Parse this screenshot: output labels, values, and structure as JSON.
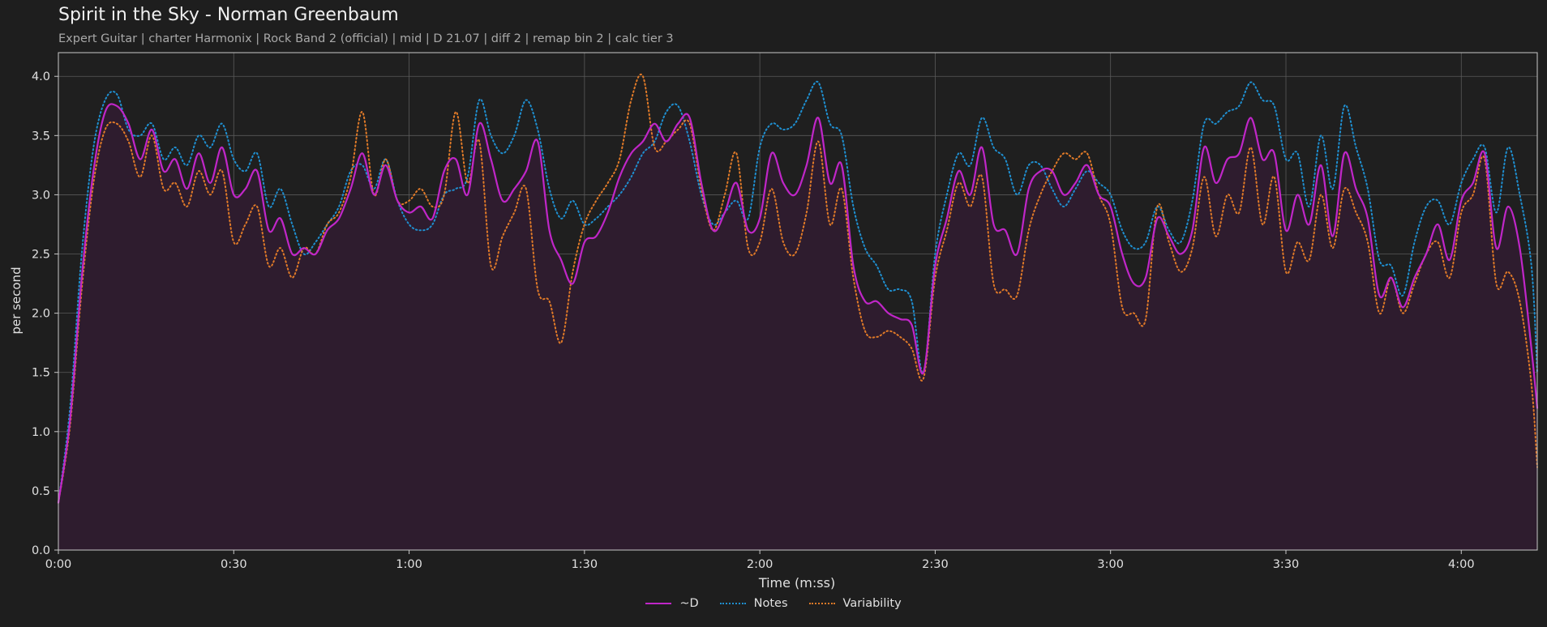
{
  "header": {
    "title": "Spirit in the Sky - Norman Greenbaum",
    "subtitle": "Expert Guitar  |  charter Harmonix  |  Rock Band 2 (official)  |  mid  |  D 21.07  |  diff 2  |  remap bin 2  |  calc tier 3"
  },
  "colors": {
    "background": "#1e1e1e",
    "d": "#c026c8",
    "d_fill": "#2e1c2e",
    "notes": "#1f8fd0",
    "variability": "#e07a28",
    "grid": "#5a5a5a",
    "axis": "#c8c8c8"
  },
  "chart_data": {
    "type": "line",
    "title": "Spirit in the Sky - Norman Greenbaum",
    "xlabel": "Time (m:ss)",
    "ylabel": "per second",
    "xlim": [
      0,
      253
    ],
    "ylim": [
      0,
      4.2
    ],
    "grid": true,
    "legend_position": "bottom-center",
    "x_ticks": [
      0,
      30,
      60,
      90,
      120,
      150,
      180,
      210,
      240
    ],
    "x_tick_labels": [
      "0:00",
      "0:30",
      "1:00",
      "1:30",
      "2:00",
      "2:30",
      "3:00",
      "3:30",
      "4:00"
    ],
    "y_ticks": [
      0,
      0.5,
      1.0,
      1.5,
      2.0,
      2.5,
      3.0,
      3.5,
      4.0
    ],
    "y_tick_labels": [
      "0.0",
      "0.5",
      "1.0",
      "1.5",
      "2.0",
      "2.5",
      "3.0",
      "3.5",
      "4.0"
    ],
    "x": [
      0,
      2,
      4,
      6,
      8,
      10,
      12,
      14,
      16,
      18,
      20,
      22,
      24,
      26,
      28,
      30,
      32,
      34,
      36,
      38,
      40,
      42,
      44,
      46,
      48,
      50,
      52,
      54,
      56,
      58,
      60,
      62,
      64,
      66,
      68,
      70,
      72,
      74,
      76,
      78,
      80,
      82,
      84,
      86,
      88,
      90,
      92,
      94,
      96,
      98,
      100,
      102,
      104,
      106,
      108,
      110,
      112,
      114,
      116,
      118,
      120,
      122,
      124,
      126,
      128,
      130,
      132,
      134,
      136,
      138,
      140,
      142,
      144,
      146,
      148,
      150,
      152,
      154,
      156,
      158,
      160,
      162,
      164,
      166,
      168,
      170,
      172,
      174,
      176,
      178,
      180,
      182,
      184,
      186,
      188,
      190,
      192,
      194,
      196,
      198,
      200,
      202,
      204,
      206,
      208,
      210,
      212,
      214,
      216,
      218,
      220,
      222,
      224,
      226,
      228,
      230,
      232,
      234,
      236,
      238,
      240,
      242,
      244,
      246,
      248,
      250,
      252,
      253
    ],
    "series": [
      {
        "name": "~D",
        "style": "solid",
        "values": [
          0.4,
          1.1,
          2.3,
          3.2,
          3.7,
          3.75,
          3.6,
          3.3,
          3.55,
          3.2,
          3.3,
          3.05,
          3.35,
          3.1,
          3.4,
          3.0,
          3.05,
          3.2,
          2.7,
          2.8,
          2.5,
          2.55,
          2.5,
          2.7,
          2.8,
          3.05,
          3.35,
          3.0,
          3.25,
          2.95,
          2.85,
          2.9,
          2.8,
          3.2,
          3.3,
          3.0,
          3.6,
          3.3,
          2.95,
          3.05,
          3.2,
          3.45,
          2.7,
          2.45,
          2.25,
          2.6,
          2.65,
          2.85,
          3.15,
          3.35,
          3.45,
          3.6,
          3.45,
          3.6,
          3.65,
          3.1,
          2.7,
          2.85,
          3.1,
          2.7,
          2.8,
          3.35,
          3.1,
          3.0,
          3.25,
          3.65,
          3.1,
          3.25,
          2.4,
          2.1,
          2.1,
          2.0,
          1.95,
          1.9,
          1.5,
          2.4,
          2.8,
          3.2,
          3.0,
          3.4,
          2.75,
          2.7,
          2.5,
          3.05,
          3.2,
          3.2,
          3.0,
          3.1,
          3.25,
          3.0,
          2.9,
          2.5,
          2.25,
          2.3,
          2.8,
          2.65,
          2.5,
          2.7,
          3.4,
          3.1,
          3.3,
          3.35,
          3.65,
          3.3,
          3.35,
          2.7,
          3.0,
          2.75,
          3.25,
          2.65,
          3.35,
          3.05,
          2.8,
          2.15,
          2.3,
          2.05,
          2.3,
          2.5,
          2.75,
          2.45,
          2.95,
          3.1,
          3.35,
          2.55,
          2.9,
          2.55,
          1.7,
          1.2,
          0.45
        ]
      },
      {
        "name": "Notes",
        "style": "dotted",
        "values": [
          0.4,
          1.2,
          2.5,
          3.4,
          3.8,
          3.85,
          3.55,
          3.5,
          3.6,
          3.3,
          3.4,
          3.25,
          3.5,
          3.4,
          3.6,
          3.3,
          3.2,
          3.35,
          2.9,
          3.05,
          2.75,
          2.5,
          2.6,
          2.75,
          2.9,
          3.2,
          3.25,
          3.05,
          3.3,
          2.95,
          2.75,
          2.7,
          2.75,
          3.0,
          3.05,
          3.15,
          3.8,
          3.5,
          3.35,
          3.5,
          3.8,
          3.55,
          3.05,
          2.8,
          2.95,
          2.75,
          2.8,
          2.9,
          3.0,
          3.15,
          3.35,
          3.45,
          3.7,
          3.75,
          3.45,
          3.0,
          2.75,
          2.85,
          2.95,
          2.8,
          3.4,
          3.6,
          3.55,
          3.6,
          3.8,
          3.95,
          3.6,
          3.5,
          2.9,
          2.55,
          2.4,
          2.2,
          2.2,
          2.1,
          1.5,
          2.5,
          3.0,
          3.35,
          3.25,
          3.65,
          3.4,
          3.3,
          3.0,
          3.25,
          3.25,
          3.05,
          2.9,
          3.05,
          3.2,
          3.1,
          3.0,
          2.7,
          2.55,
          2.6,
          2.9,
          2.7,
          2.6,
          2.95,
          3.6,
          3.6,
          3.7,
          3.75,
          3.95,
          3.8,
          3.75,
          3.3,
          3.35,
          2.9,
          3.5,
          3.05,
          3.75,
          3.4,
          3.05,
          2.45,
          2.4,
          2.15,
          2.6,
          2.9,
          2.95,
          2.75,
          3.1,
          3.3,
          3.4,
          2.85,
          3.4,
          3.0,
          2.4,
          1.5,
          0.45
        ]
      },
      {
        "name": "Variability",
        "style": "dotted",
        "values": [
          0.4,
          1.05,
          2.2,
          3.1,
          3.55,
          3.6,
          3.45,
          3.15,
          3.5,
          3.05,
          3.1,
          2.9,
          3.2,
          3.0,
          3.2,
          2.6,
          2.75,
          2.9,
          2.4,
          2.55,
          2.3,
          2.55,
          2.5,
          2.75,
          2.85,
          3.15,
          3.7,
          3.0,
          3.3,
          2.95,
          2.95,
          3.05,
          2.9,
          3.0,
          3.7,
          3.1,
          3.45,
          2.4,
          2.65,
          2.85,
          3.05,
          2.2,
          2.1,
          1.75,
          2.35,
          2.75,
          2.95,
          3.1,
          3.3,
          3.8,
          4.0,
          3.4,
          3.45,
          3.55,
          3.6,
          3.05,
          2.7,
          3.0,
          3.35,
          2.55,
          2.6,
          3.05,
          2.6,
          2.5,
          2.85,
          3.45,
          2.75,
          3.05,
          2.3,
          1.85,
          1.8,
          1.85,
          1.8,
          1.7,
          1.45,
          2.3,
          2.7,
          3.1,
          2.9,
          3.15,
          2.25,
          2.2,
          2.15,
          2.7,
          3.0,
          3.2,
          3.35,
          3.3,
          3.35,
          3.0,
          2.75,
          2.05,
          2.0,
          1.95,
          2.9,
          2.6,
          2.35,
          2.55,
          3.15,
          2.65,
          3.0,
          2.85,
          3.4,
          2.75,
          3.15,
          2.35,
          2.6,
          2.45,
          3.0,
          2.55,
          3.05,
          2.85,
          2.6,
          2.0,
          2.3,
          2.0,
          2.25,
          2.5,
          2.6,
          2.3,
          2.85,
          3.0,
          3.3,
          2.25,
          2.35,
          2.1,
          1.4,
          0.7,
          0.1
        ]
      }
    ]
  },
  "legend": {
    "items": [
      {
        "label": "~D",
        "color": "#c026c8",
        "style": "solid"
      },
      {
        "label": "Notes",
        "color": "#1f8fd0",
        "style": "dotted"
      },
      {
        "label": "Variability",
        "color": "#e07a28",
        "style": "dotted"
      }
    ]
  }
}
